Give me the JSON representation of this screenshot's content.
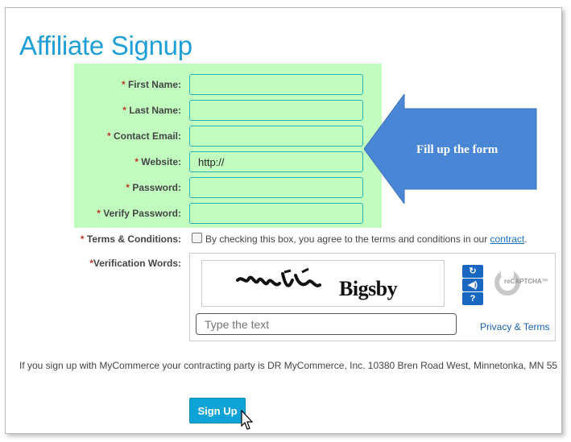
{
  "page_title": "Affiliate Signup",
  "form": {
    "fields": [
      {
        "label": "First Name:",
        "value": "",
        "placeholder": ""
      },
      {
        "label": "Last Name:",
        "value": "",
        "placeholder": ""
      },
      {
        "label": "Contact Email:",
        "value": "",
        "placeholder": ""
      },
      {
        "label": "Website:",
        "value": "http://",
        "placeholder": ""
      },
      {
        "label": "Password:",
        "value": "",
        "placeholder": ""
      },
      {
        "label": "Verify Password:",
        "value": "",
        "placeholder": ""
      }
    ],
    "required_marker": "*",
    "highlight_color": "#c2fdc0"
  },
  "callout": {
    "text": "Fill up the form",
    "color": "#4a86d6"
  },
  "terms": {
    "label": "Terms & Conditions:",
    "checked": false,
    "text": "By checking this box, you agree to the terms and conditions in our",
    "link": "contract",
    "period": "."
  },
  "captcha": {
    "label": "Verification Words:",
    "word_distorted": "myi",
    "word": "Bigsby",
    "input_placeholder": "Type the text",
    "privacy": "Privacy & Terms",
    "logo": "reCAPTCHA™",
    "buttons": [
      "refresh-icon",
      "audio-icon",
      "help-icon"
    ]
  },
  "contract_notice": "If you sign up with MyCommerce your contracting party is DR MyCommerce, Inc. 10380 Bren Road West, Minnetonka, MN 55",
  "submit": {
    "label": "Sign Up",
    "color": "#0ea3d6"
  },
  "title_color": "#1f9fd6"
}
